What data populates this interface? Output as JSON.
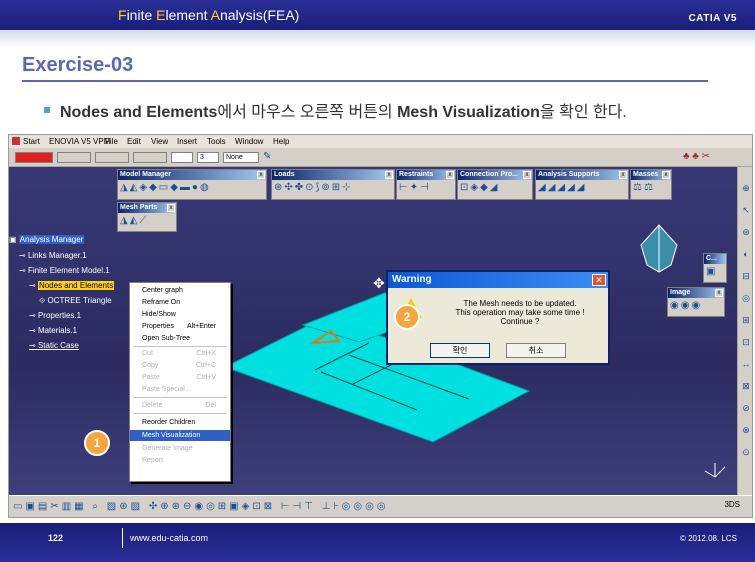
{
  "header": {
    "title_parts": [
      "F",
      "inite ",
      "E",
      "lement ",
      "A",
      "nalysis(FEA)"
    ],
    "brand": "CATIA V5"
  },
  "exercise": "Exercise-03",
  "bullet": {
    "bold1": "Nodes and Elements",
    "text1": "에서 마우스 오른쪽 버튼의 ",
    "bold2": "Mesh Visualization",
    "text2": "을 확인 한다."
  },
  "catia": {
    "menu": [
      "Start",
      "ENOVIA V5 VPM",
      "File",
      "Edit",
      "View",
      "Insert",
      "Tools",
      "Window",
      "Help"
    ],
    "prop_values": {
      "layer": "None",
      "thickness": "3"
    },
    "toolbars": [
      "Model Manager",
      "Loads",
      "Restraints",
      "Connection Pro...",
      "Analysis Supports",
      "Masses",
      "Mesh Parts",
      "C...",
      "Image"
    ],
    "tree": [
      "Analysis Manager",
      "Links Manager.1",
      "Finite Element Model.1",
      "Nodes and Elements",
      "OCTREE Triangle",
      "Properties.1",
      "Materials.1",
      "Static Case"
    ],
    "context_menu": [
      {
        "label": "Center graph",
        "shortcut": "",
        "disabled": false
      },
      {
        "label": "Reframe On",
        "shortcut": "",
        "disabled": false
      },
      {
        "label": "Hide/Show",
        "shortcut": "",
        "disabled": false
      },
      {
        "label": "Properties",
        "shortcut": "Alt+Enter",
        "disabled": false
      },
      {
        "label": "Open Sub-Tree",
        "shortcut": "",
        "disabled": false
      },
      {
        "label": "Cut",
        "shortcut": "Ctrl+X",
        "disabled": true
      },
      {
        "label": "Copy",
        "shortcut": "Ctrl+C",
        "disabled": true
      },
      {
        "label": "Paste",
        "shortcut": "Ctrl+V",
        "disabled": true
      },
      {
        "label": "Paste Special...",
        "shortcut": "",
        "disabled": true
      },
      {
        "label": "Delete",
        "shortcut": "Del",
        "disabled": true
      },
      {
        "label": "Reorder Children",
        "shortcut": "",
        "disabled": false
      },
      {
        "label": "Mesh Visualization",
        "shortcut": "",
        "disabled": false
      },
      {
        "label": "Generate Image",
        "shortcut": "",
        "disabled": true
      },
      {
        "label": "Report",
        "shortcut": "",
        "disabled": true
      }
    ],
    "dialog": {
      "title": "Warning",
      "line1": "The Mesh needs to be updated.",
      "line2": "This operation may take some time !",
      "line3": "Continue ?",
      "ok": "확인",
      "cancel": "취소",
      "icon": "warning-icon"
    }
  },
  "badges": [
    "1",
    "2"
  ],
  "footer": {
    "page": "122",
    "url": "www.edu-catia.com",
    "copyright": "© 2012.08. LCS"
  },
  "colors": {
    "header": "#1a1e7a",
    "accent": "#ffd21a",
    "exercise": "#5a66b8",
    "mesh": "#00e0e0",
    "badge": "#f5a53a"
  }
}
